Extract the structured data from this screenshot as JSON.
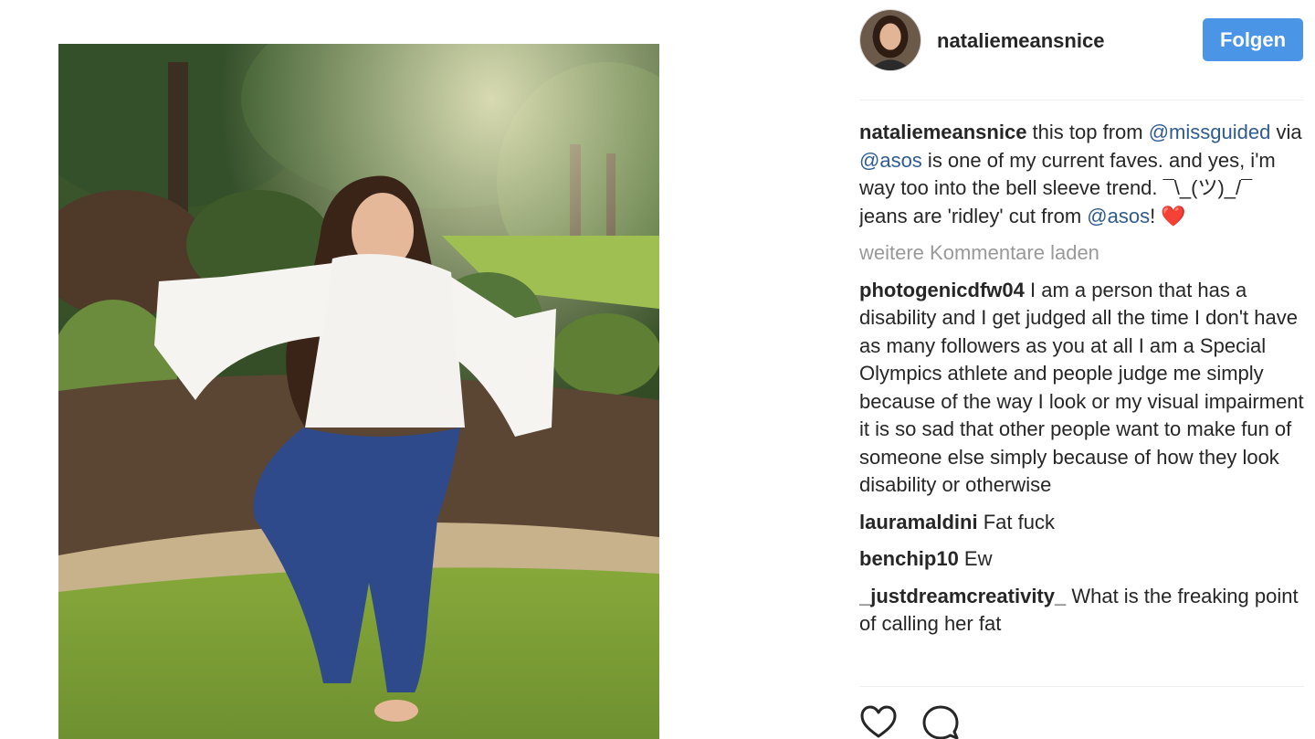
{
  "post": {
    "username": "nataliemeansnice",
    "follow_label": "Folgen",
    "caption": {
      "user": "nataliemeansnice",
      "t1": " this top from ",
      "m1": "@missguided",
      "t2": " via ",
      "m2": "@asos",
      "t3": " is one of my current faves. and yes, i'm way too into the bell sleeve trend. ¯\\_(ツ)_/¯ jeans are 'ridley' cut from ",
      "m3": "@asos",
      "t4": "! ❤️"
    },
    "load_more_label": "weitere Kommentare laden",
    "comments": [
      {
        "user": "photogenicdfw04",
        "text": " I am a person that has a disability and I get judged all the time I don't have as many followers as you at all I am a Special Olympics athlete and people judge me simply because of the way I look or my visual impairment it is so sad that other people want to make fun of someone else simply because of how they look disability or otherwise"
      },
      {
        "user": "lauramaldini",
        "text": " Fat fuck"
      },
      {
        "user": "benchip10",
        "text": " Ew"
      },
      {
        "user": "_justdreamcreativity_",
        "text": " What is the freaking point of calling her fat"
      }
    ],
    "icons": {
      "like": "heart-icon",
      "comment": "comment-bubble-icon"
    }
  },
  "colors": {
    "follow_button": "#4a95e6",
    "mention": "#2f5b8f",
    "muted": "#999999",
    "text": "#262626"
  }
}
